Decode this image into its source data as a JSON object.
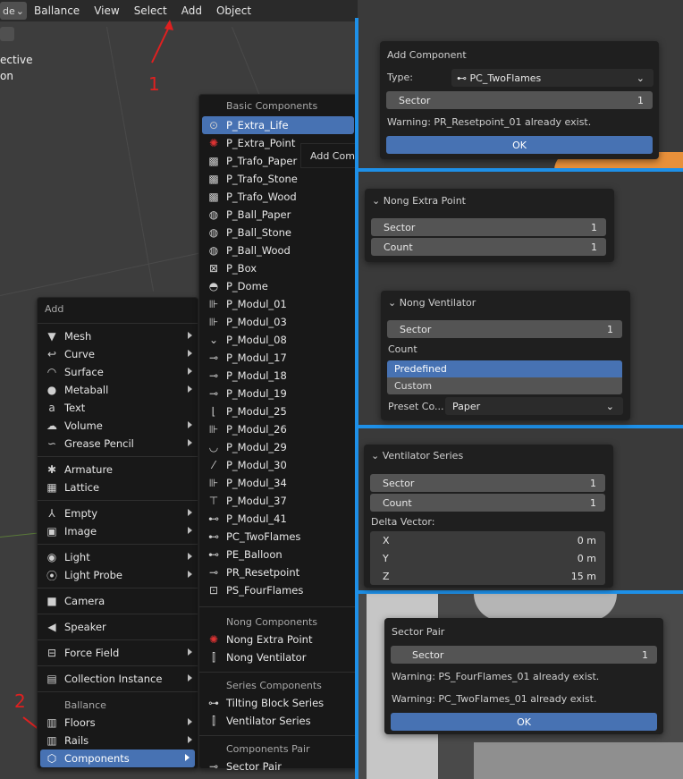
{
  "header": {
    "mode_label": "de",
    "menu": [
      "Ballance",
      "View",
      "Select",
      "Add",
      "Object"
    ]
  },
  "viewport": {
    "line1": "ective",
    "line2": "on"
  },
  "annotations": {
    "step1": "1",
    "step2": "2"
  },
  "add_menu": {
    "title": "Add",
    "items": [
      {
        "icon": "mesh-icon",
        "label": "Mesh",
        "sub": true
      },
      {
        "icon": "curve-icon",
        "label": "Curve",
        "sub": true
      },
      {
        "icon": "surface-icon",
        "label": "Surface",
        "sub": true
      },
      {
        "icon": "metaball-icon",
        "label": "Metaball",
        "sub": true
      },
      {
        "icon": "text-icon",
        "label": "Text",
        "sub": false
      },
      {
        "icon": "volume-icon",
        "label": "Volume",
        "sub": true
      },
      {
        "icon": "grease-pencil-icon",
        "label": "Grease Pencil",
        "sub": true
      },
      {
        "icon": "armature-icon",
        "label": "Armature",
        "sub": false
      },
      {
        "icon": "lattice-icon",
        "label": "Lattice",
        "sub": false
      },
      {
        "icon": "empty-icon",
        "label": "Empty",
        "sub": true
      },
      {
        "icon": "image-icon",
        "label": "Image",
        "sub": true
      },
      {
        "icon": "light-icon",
        "label": "Light",
        "sub": true
      },
      {
        "icon": "light-probe-icon",
        "label": "Light Probe",
        "sub": true
      },
      {
        "icon": "camera-icon",
        "label": "Camera",
        "sub": false
      },
      {
        "icon": "speaker-icon",
        "label": "Speaker",
        "sub": false
      },
      {
        "icon": "force-field-icon",
        "label": "Force Field",
        "sub": true
      },
      {
        "icon": "collection-instance-icon",
        "label": "Collection Instance",
        "sub": true
      }
    ],
    "section_ballance": "Ballance",
    "ballance_items": [
      {
        "icon": "floors-icon",
        "label": "Floors",
        "sub": true
      },
      {
        "icon": "rails-icon",
        "label": "Rails",
        "sub": true
      },
      {
        "icon": "components-icon",
        "label": "Components",
        "sub": true
      }
    ]
  },
  "components_menu": {
    "basic_header": "Basic Components",
    "basic": [
      "P_Extra_Life",
      "P_Extra_Point",
      "P_Trafo_Paper",
      "P_Trafo_Stone",
      "P_Trafo_Wood",
      "P_Ball_Paper",
      "P_Ball_Stone",
      "P_Ball_Wood",
      "P_Box",
      "P_Dome",
      "P_Modul_01",
      "P_Modul_03",
      "P_Modul_08",
      "P_Modul_17",
      "P_Modul_18",
      "P_Modul_19",
      "P_Modul_25",
      "P_Modul_26",
      "P_Modul_29",
      "P_Modul_30",
      "P_Modul_34",
      "P_Modul_37",
      "P_Modul_41",
      "PC_TwoFlames",
      "PE_Balloon",
      "PR_Resetpoint",
      "PS_FourFlames"
    ],
    "nong_header": "Nong Components",
    "nong": [
      "Nong Extra Point",
      "Nong Ventilator"
    ],
    "series_header": "Series Components",
    "series": [
      "Tilting Block Series",
      "Ventilator Series"
    ],
    "pair_header": "Components Pair",
    "pair": [
      "Sector Pair"
    ],
    "tooltip": "Add Comp"
  },
  "panel_add_component": {
    "title": "Add Component",
    "type_label": "Type:",
    "type_value": "PC_TwoFlames",
    "sector_label": "Sector",
    "sector_value": "1",
    "warning": "Warning: PR_Resetpoint_01 already exist.",
    "ok": "OK"
  },
  "panel_nong_extra_point": {
    "title": "Nong Extra Point",
    "sector_label": "Sector",
    "sector_value": "1",
    "count_label": "Count",
    "count_value": "1"
  },
  "panel_nong_ventilator": {
    "title": "Nong Ventilator",
    "sector_label": "Sector",
    "sector_value": "1",
    "count_label": "Count",
    "opt_predefined": "Predefined",
    "opt_custom": "Custom",
    "preset_label": "Preset Co...",
    "preset_value": "Paper"
  },
  "panel_ventilator_series": {
    "title": "Ventilator Series",
    "sector_label": "Sector",
    "sector_value": "1",
    "count_label": "Count",
    "count_value": "1",
    "delta_label": "Delta Vector:",
    "x_label": "X",
    "x_value": "0 m",
    "y_label": "Y",
    "y_value": "0 m",
    "z_label": "Z",
    "z_value": "15 m"
  },
  "panel_sector_pair": {
    "title": "Sector Pair",
    "sector_label": "Sector",
    "sector_value": "1",
    "warning1": "Warning: PS_FourFlames_01 already exist.",
    "warning2": "Warning: PC_TwoFlames_01 already exist.",
    "ok": "OK"
  },
  "colors": {
    "accent": "#4772b3",
    "divider": "#1e90e8",
    "annotation": "#e02020"
  }
}
